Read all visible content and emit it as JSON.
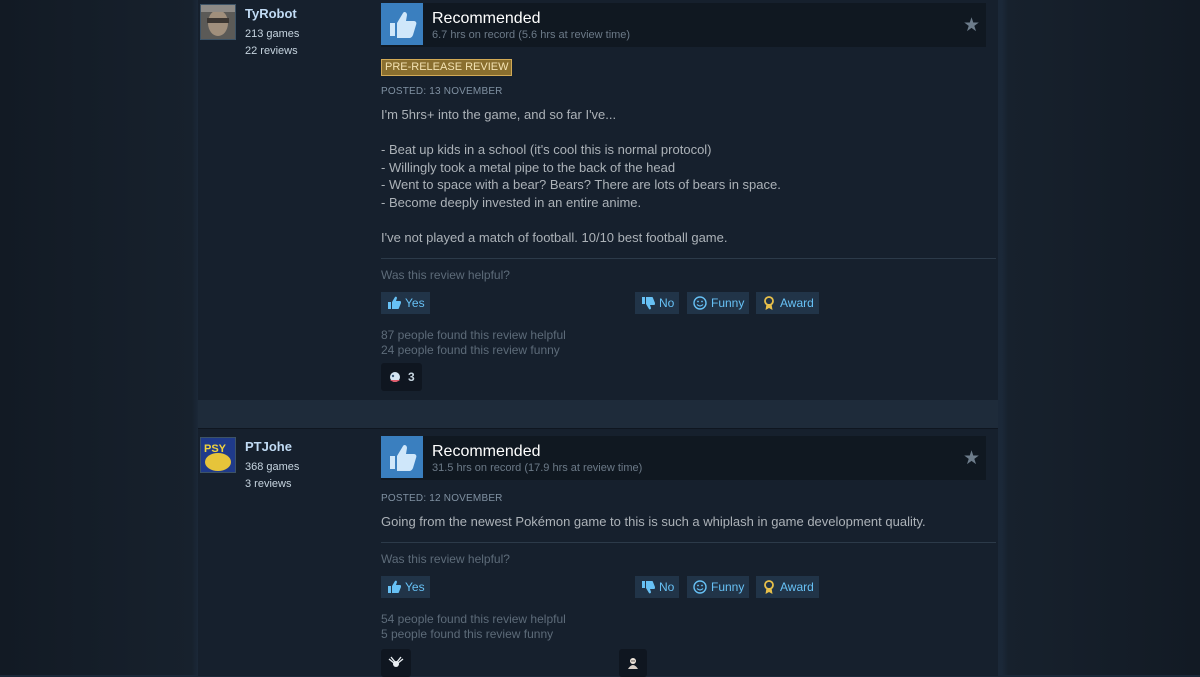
{
  "colors": {
    "link": "#67c1f5",
    "recommended_blue": "#3a7fbf",
    "badge": "#8a6f2f"
  },
  "reviews": [
    {
      "user": {
        "name": "TyRobot",
        "games": "213 games",
        "reviews": "22 reviews",
        "avatar_icon": "photo-avatar"
      },
      "verdict": "Recommended",
      "hours": "6.7 hrs on record (5.6 hrs at review time)",
      "badge": "PRE-RELEASE REVIEW",
      "posted": "POSTED: 13 NOVEMBER",
      "body": "I'm 5hrs+ into the game, and so far I've...\n\n- Beat up kids in a school (it's cool this is normal protocol)\n- Willingly took a metal pipe to the back of the head\n- Went to space with a bear? Bears? There are lots of bears in space.\n- Become deeply invested in an entire anime.\n\nI've not played a match of football. 10/10 best football game.",
      "helpful_question": "Was this review helpful?",
      "buttons": {
        "yes": "Yes",
        "no": "No",
        "funny": "Funny",
        "award": "Award"
      },
      "found_helpful": "87 people found this review helpful",
      "found_funny": "24 people found this review funny",
      "awards": [
        {
          "icon": "award-icon",
          "count": "3"
        }
      ]
    },
    {
      "user": {
        "name": "PTJohe",
        "games": "368 games",
        "reviews": "3 reviews",
        "avatar_icon": "psyduck-avatar"
      },
      "verdict": "Recommended",
      "hours": "31.5 hrs on record (17.9 hrs at review time)",
      "posted": "POSTED: 12 NOVEMBER",
      "body": "Going from the newest Pokémon game to this is such a whiplash in game development quality.",
      "helpful_question": "Was this review helpful?",
      "buttons": {
        "yes": "Yes",
        "no": "No",
        "funny": "Funny",
        "award": "Award"
      },
      "found_helpful": "54 people found this review helpful",
      "found_funny": "5 people found this review funny",
      "awards": [
        {
          "icon": "award-icon"
        },
        {
          "icon": "award-icon"
        }
      ]
    }
  ]
}
